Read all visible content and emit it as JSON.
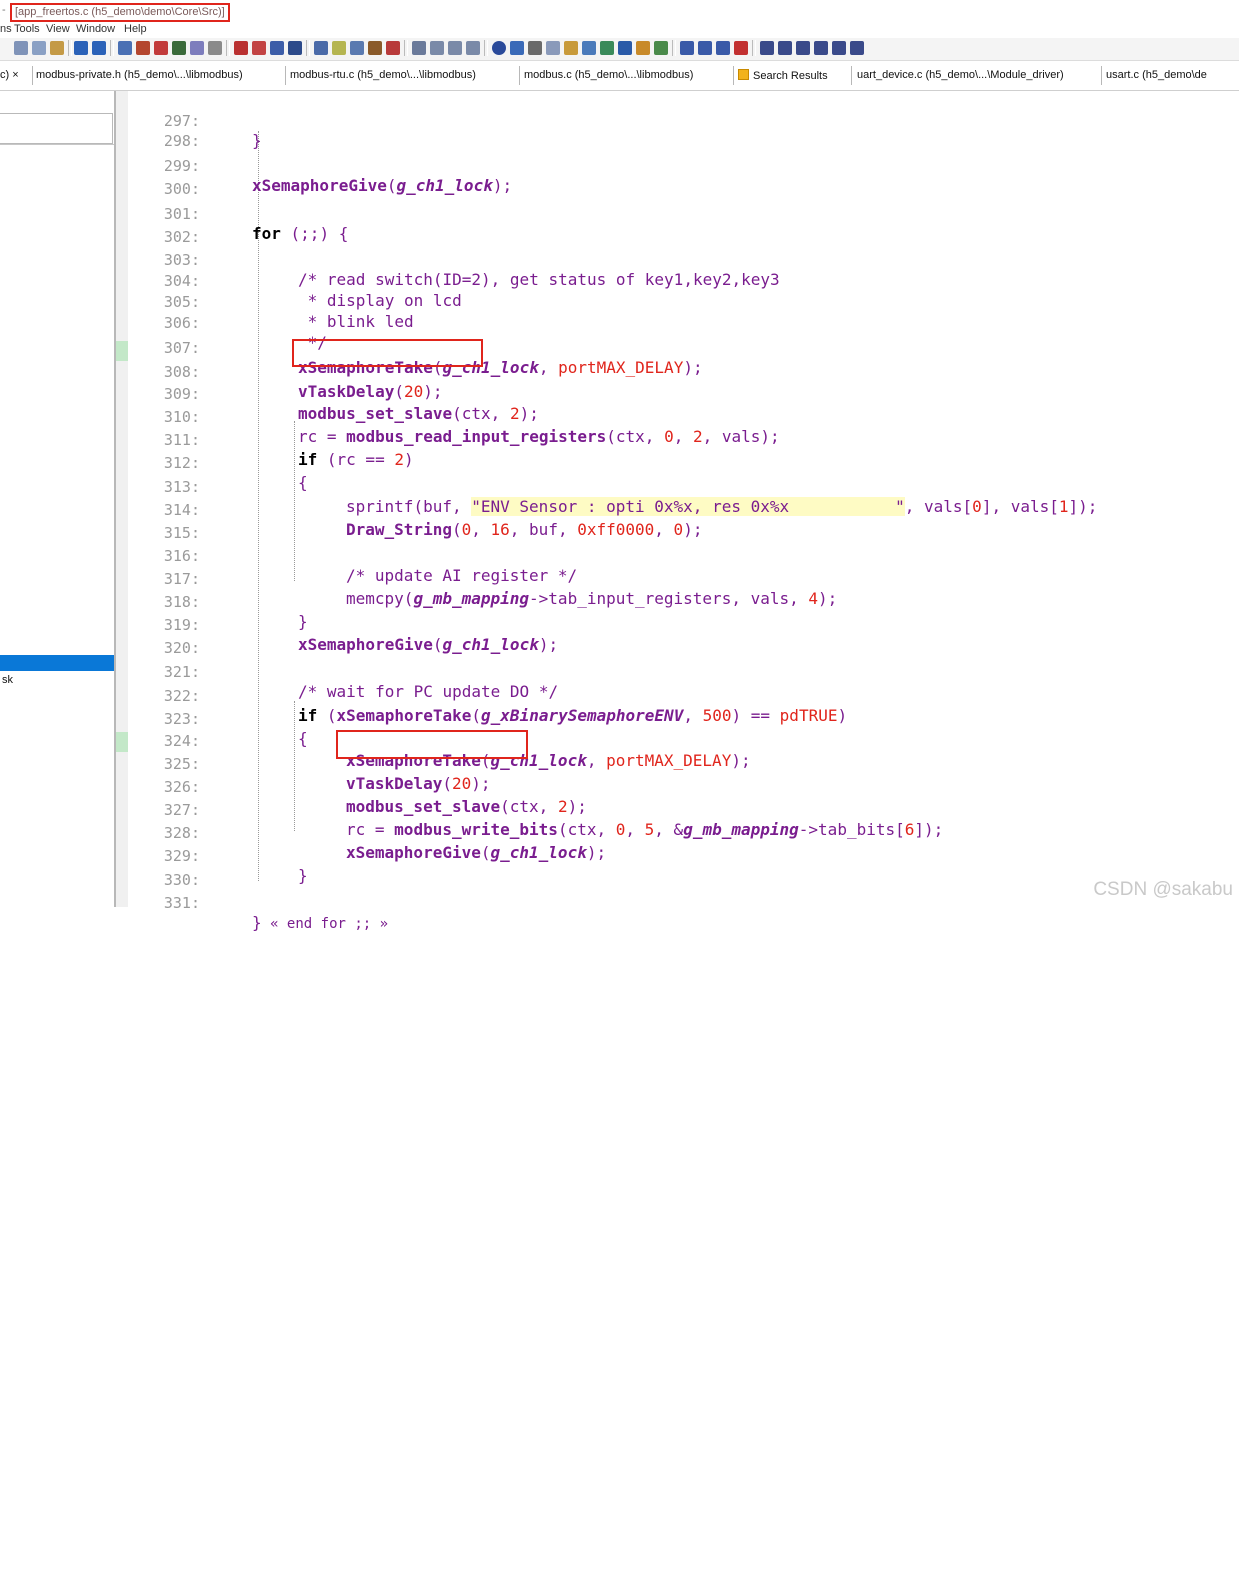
{
  "window": {
    "title": "[app_freertos.c (h5_demo\\demo\\Core\\Src)]",
    "title_prefix": "-"
  },
  "menu": [
    "ns",
    "Tools",
    "View",
    "Window",
    "Help"
  ],
  "tabs": [
    {
      "label": "c) ×",
      "kind": "close"
    },
    {
      "label": "modbus-private.h (h5_demo\\...\\libmodbus)"
    },
    {
      "label": "modbus-rtu.c (h5_demo\\...\\libmodbus)"
    },
    {
      "label": "modbus.c (h5_demo\\...\\libmodbus)"
    },
    {
      "label": "Search Results",
      "icon": "search-results-icon"
    },
    {
      "label": "uart_device.c (h5_demo\\...\\Module_driver)"
    },
    {
      "label": "usart.c (h5_demo\\de"
    }
  ],
  "left_panel": {
    "item_text": "sk"
  },
  "code": {
    "line_numbers": [
      "297:",
      "298:",
      "299:",
      "300:",
      "301:",
      "302:",
      "303:",
      "304:",
      "305:",
      "306:",
      "307:",
      "308:",
      "309:",
      "310:",
      "311:",
      "312:",
      "313:",
      "314:",
      "315:",
      "316:",
      "317:",
      "318:",
      "319:",
      "320:",
      "321:",
      "322:",
      "323:",
      "324:",
      "325:",
      "326:",
      "327:",
      "328:",
      "329:",
      "330:",
      "331:"
    ],
    "t": {
      "brace_close": "}",
      "brace_open": "{",
      "l299_fn": "xSemaphoreGive",
      "l299_arg": "g_ch1_lock",
      "l301_kw": "for",
      "l301_rest": " (;;) {",
      "l303": "/* read switch(ID=2), get status of key1,key2,key3",
      "l304": " * display on lcd",
      "l305": " * blink led",
      "l306": " */",
      "l307_fn": "xSemaphoreTake",
      "l307_arg": "g_ch1_lock",
      "l307_mac": "portMAX_DELAY",
      "l308_fn": "vTaskDelay",
      "l308_num": "20",
      "l309_fn": "modbus_set_slave",
      "l309_args": "ctx, ",
      "l309_num": "2",
      "l310_a": "rc = ",
      "l310_fn": "modbus_read_input_registers",
      "l310_b": "ctx, ",
      "l310_n1": "0",
      "l310_n2": "2",
      "l310_c": ", vals);",
      "l311_kw": "if",
      "l311_a": " (rc == ",
      "l311_num": "2",
      "l313_fn": "sprintf",
      "l313_a": "buf, ",
      "l313_str": "\"ENV Sensor : opti 0x%x, res 0x%x           \"",
      "l313_b": ", vals[",
      "l313_n1": "0",
      "l313_c": "], vals[",
      "l313_n2": "1",
      "l313_d": "]);",
      "l314_fn": "Draw_String",
      "l314_n1": "0",
      "l314_n2": "16",
      "l314_a": ", buf, ",
      "l314_n3": "0xff0000",
      "l314_n4": "0",
      "l316": "/* update AI register */",
      "l317_fn": "memcpy",
      "l317_arg": "g_mb_mapping",
      "l317_a": "->tab_input_registers, vals, ",
      "l317_num": "4",
      "l321": "/* wait for PC update DO */",
      "l322_kw": "if",
      "l322_fn": "xSemaphoreTake",
      "l322_arg": "g_xBinarySemaphoreENV",
      "l322_num": "500",
      "l322_mac": "pdTRUE",
      "l327_a": "rc = ",
      "l327_fn": "modbus_write_bits",
      "l327_n1": "0",
      "l327_n2": "5",
      "l327_arg": "g_mb_mapping",
      "l327_b": "->tab_bits[",
      "l327_n3": "6",
      "l331_rest": " « end for ;; »"
    }
  },
  "watermark": "CSDN @sakabu",
  "colors": {
    "accent_red": "#e0251c",
    "keyword_purple": "#7a1d8f",
    "string_highlight": "#fefbc4",
    "selection_blue": "#0a78d7",
    "gutter_green": "#c3e8c8"
  }
}
